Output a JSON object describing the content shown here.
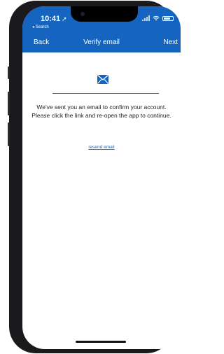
{
  "status_bar": {
    "time": "10:41",
    "location_icon": "➚",
    "back_app": "◂ Search"
  },
  "nav": {
    "back_label": "Back",
    "title": "Verify email",
    "next_label": "Next"
  },
  "content": {
    "icon": "mail-icon",
    "message": "We've sent you an email to confirm your account. Please click the link and re-open the app to continue.",
    "resend_label": "resend email"
  },
  "colors": {
    "accent": "#1565c0",
    "background": "#ffffff",
    "bezel": "#1a1a1c"
  }
}
